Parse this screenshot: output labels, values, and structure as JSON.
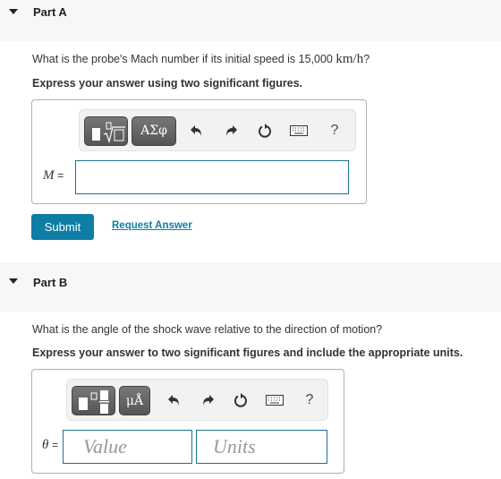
{
  "partA": {
    "title": "Part A",
    "question_prefix": "What is the probe's Mach number if its initial speed is 15,000 ",
    "question_unit": "km/h",
    "question_suffix": "?",
    "instruction": "Express your answer using two significant figures.",
    "toolbar": {
      "template_icon": "fraction-root-template-icon",
      "greek_label": "ΑΣφ",
      "undo_icon": "undo-icon",
      "redo_icon": "redo-icon",
      "reset_icon": "reset-icon",
      "keyboard_icon": "keyboard-icon",
      "help_label": "?"
    },
    "variable": "M",
    "equals": "=",
    "answer_value": "",
    "submit_label": "Submit",
    "request_label": "Request Answer"
  },
  "partB": {
    "title": "Part B",
    "question": "What is the angle of the shock wave relative to the direction of motion?",
    "instruction": "Express your answer to two significant figures and include the appropriate units.",
    "toolbar": {
      "template_icon": "value-fraction-template-icon",
      "units_label": "μÅ",
      "undo_icon": "undo-icon",
      "redo_icon": "redo-icon",
      "reset_icon": "reset-icon",
      "keyboard_icon": "keyboard-icon",
      "help_label": "?"
    },
    "variable": "θ",
    "equals": "=",
    "value_placeholder": "Value",
    "units_placeholder": "Units"
  },
  "colors": {
    "accent": "#0e7ea5",
    "input_border": "#1a7390",
    "header_bg": "#f7f7f7"
  }
}
